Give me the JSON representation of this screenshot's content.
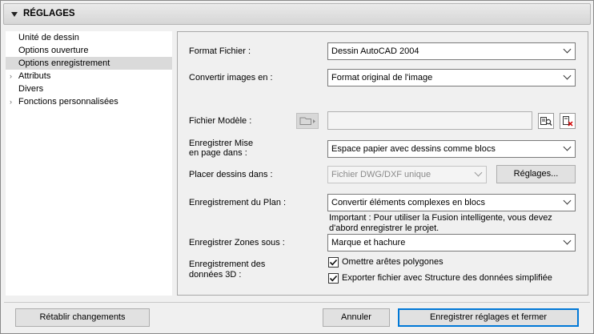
{
  "header": {
    "title": "RÉGLAGES"
  },
  "tree": {
    "items": [
      {
        "label": "Unité de dessin",
        "arrow": ""
      },
      {
        "label": "Options ouverture",
        "arrow": ""
      },
      {
        "label": "Options enregistrement",
        "arrow": ""
      },
      {
        "label": "Attributs",
        "arrow": "›"
      },
      {
        "label": "Divers",
        "arrow": ""
      },
      {
        "label": "Fonctions personnalisées",
        "arrow": "›"
      }
    ],
    "selected": "Options enregistrement"
  },
  "form": {
    "format_label": "Format Fichier :",
    "format_value": "Dessin AutoCAD 2004",
    "convert_label": "Convertir images en :",
    "convert_value": "Format original de l'image",
    "template_label": "Fichier Modèle :",
    "template_value": "",
    "layout_label_1": "Enregistrer Mise",
    "layout_label_2": "en page dans :",
    "layout_value": "Espace papier avec dessins comme blocs",
    "place_label": "Placer dessins dans :",
    "place_value": "Fichier DWG/DXF unique",
    "settings_button": "Réglages...",
    "plan_label": "Enregistrement du Plan :",
    "plan_value": "Convertir éléments complexes en blocs",
    "note_1": "Important : Pour utiliser la Fusion intelligente, vous devez",
    "note_2": "d'abord enregistrer le projet.",
    "zones_label": "Enregistrer Zones sous :",
    "zones_value": "Marque et hachure",
    "data3d_label_1": "Enregistrement des",
    "data3d_label_2": "données 3D :",
    "omit_label": "Omettre arêtes polygones",
    "omit_checked": true,
    "export_label": "Exporter fichier avec Structure des données simplifiée",
    "export_checked": true
  },
  "footer": {
    "reset_button": "Rétablir changements",
    "cancel_button": "Annuler",
    "save_button": "Enregistrer réglages et fermer"
  },
  "icons": {
    "collapse": "triangle-down-icon",
    "folder": "folder-icon",
    "browse": "browse-icon",
    "clear": "clear-icon",
    "check": "checkmark-icon",
    "accent": "#0078d7"
  }
}
